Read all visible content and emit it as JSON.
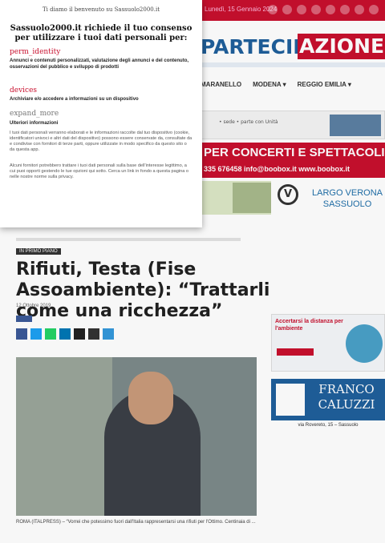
{
  "topbar": {
    "date": "Lunedì, 15 Gennaio 2024"
  },
  "masthead": {
    "left": "PARTECIP",
    "right": "AZIONE"
  },
  "nav": {
    "items": [
      "MARANELLO",
      "MODENA ▾",
      "REGGIO EMILIA ▾"
    ]
  },
  "ads": {
    "ad1_text": "• sede   • parte con Unità",
    "ad2_line1": "PER CONCERTI E SPETTACOLI",
    "ad2_line2": "335 676458   info@boobox.it   www.boobox.it",
    "ad4_logo": "V",
    "ad4_text": "LARGO VERONA SASSUOLO",
    "side1_title": "Accertarsi la distanza per l'ambiente",
    "side2_name": "FRANCO CALUZZI",
    "side2_addr": "via Rovereto, 15 – Sassuolo"
  },
  "article": {
    "tag": "IN PRIMO PIANO",
    "title": "Rifiuti, Testa (Fise Assoambiente): “Trattarli come una ricchezza”",
    "date": "12 Ottobre 2019",
    "body": "ROMA (ITALPRESS) – “Vorrei che potessimo fuori dall'Italia rappresentarsi una  rifiuti per l'Ottimo. Centinaia di ..."
  },
  "consent": {
    "greeting": "Ti diamo il benvenuto su Sassuolo2000.it",
    "heading": "Sassuolo2000.it richiede il tuo consenso per utilizzare i tuoi dati personali per:",
    "sections": [
      {
        "title": "perm_identity",
        "text": "Annunci e contenuti personalizzati, valutazione degli annunci e del contenuto, osservazioni del pubblico e sviluppo di prodotti"
      },
      {
        "title": "devices",
        "text": "Archiviare e/o accedere a informazioni su un dispositivo"
      },
      {
        "title": "expand_more",
        "subtitle": "Ulteriori informazioni"
      }
    ],
    "fine_print_1": "I tuoi dati personali verranno elaborati e le informazioni raccolte dal tuo dispositivo (cookie, identificatori univoci e altri dati del dispositivo) possono essere conservate da, consultate da e condivise con fornitori di terze parti, oppure utilizzate in modo specifico da questo sito o da questa app.",
    "fine_print_2": "Alcuni fornitori potrebbero trattare i tuoi dati personali sulla base dell'interesse legittimo, a cui puoi opporti gestendo le tue opzioni qui sotto. Cerca un link in fondo a questa pagina o nelle nostre norme sulla privacy."
  },
  "colors": {
    "brand_red": "#c8102e",
    "brand_blue": "#1f5f9b"
  }
}
